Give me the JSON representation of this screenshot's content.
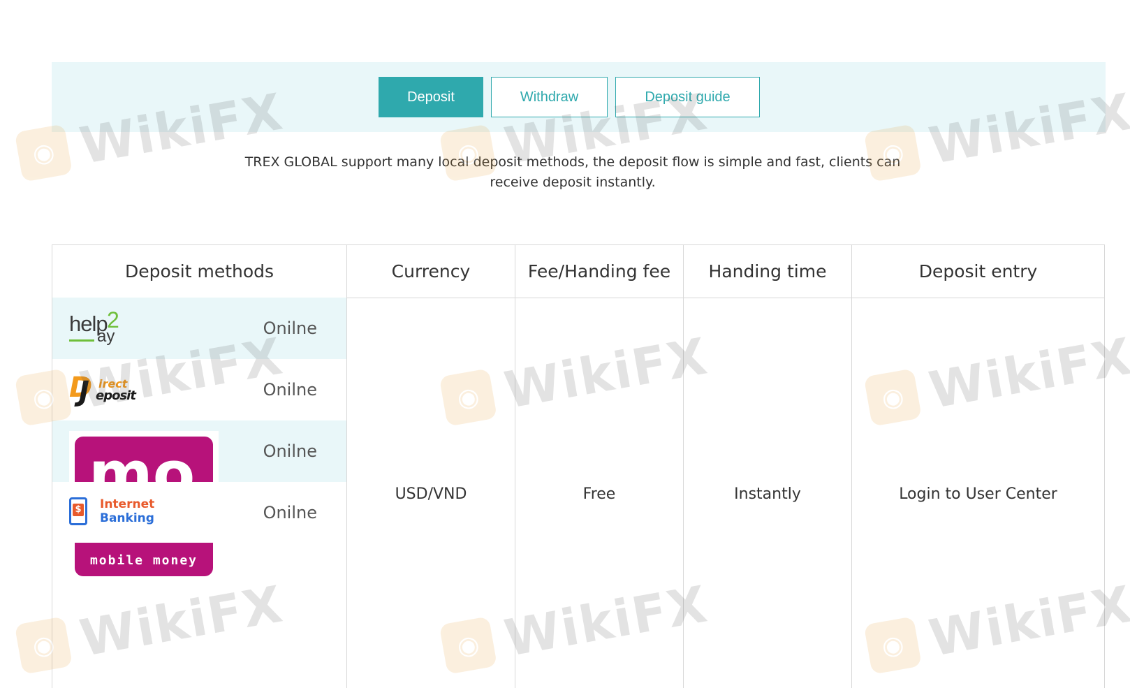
{
  "tabs": {
    "deposit": "Deposit",
    "withdraw": "Withdraw",
    "guide": "Deposit guide"
  },
  "intro": {
    "text": "TREX GLOBAL support many local deposit methods, the deposit flow is simple and fast, clients can receive deposit instantly."
  },
  "table": {
    "headers": [
      "Deposit methods",
      "Currency",
      "Fee/Handing fee",
      "Handing time",
      "Deposit entry"
    ],
    "methods": [
      {
        "logo": "help2pay-logo",
        "status": "Onilne"
      },
      {
        "logo": "direct-deposit-logo",
        "status": "Onilne"
      },
      {
        "logo": "mobile-money-logo",
        "status": "Onilne"
      },
      {
        "logo": "internet-banking-logo",
        "status": "Onilne"
      }
    ],
    "currency": "USD/VND",
    "fee": "Free",
    "time": "Instantly",
    "entry": "Login to User Center"
  },
  "logos": {
    "help2pay": {
      "a": "help",
      "b": "2",
      "c": "ay"
    },
    "direct_deposit": {
      "a": "D",
      "b": "J",
      "c": "irect",
      "d": "eposit"
    },
    "mobile_money": {
      "big": "mo",
      "caption": "mobile money"
    },
    "internet_banking": {
      "line1": "Internet",
      "line2": "Banking",
      "glyph": "$"
    }
  },
  "watermark": {
    "text": "WikiFX"
  },
  "colors": {
    "accent": "#2fa9ad",
    "banner": "#e9f7f9",
    "mobile_money": "#b7127a"
  }
}
